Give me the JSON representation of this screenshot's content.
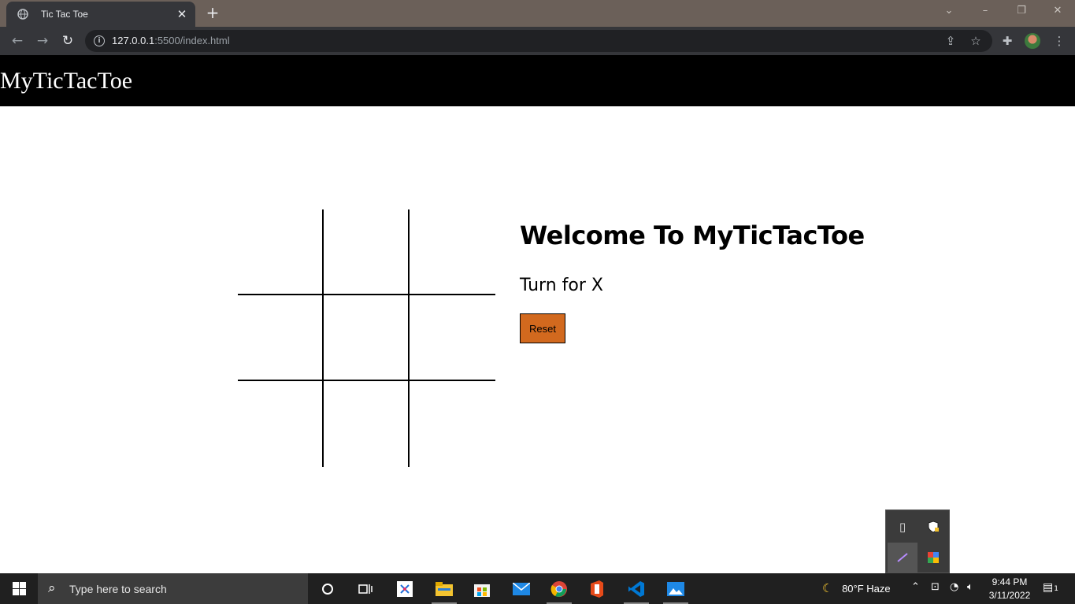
{
  "browser": {
    "tab_title": "Tic Tac Toe",
    "close_tab": "✕",
    "new_tab": "+",
    "url_host": "127.0.0.1",
    "url_rest": ":5500/index.html"
  },
  "page": {
    "site_title": "MyTicTacToe",
    "welcome": "Welcome To MyTicTacToe",
    "turn_text": "Turn for X",
    "reset_label": "Reset",
    "board": [
      "",
      "",
      "",
      "",
      "",
      "",
      "",
      "",
      ""
    ],
    "colors": {
      "header_bg": "#000000",
      "reset_bg": "#d2691e"
    }
  },
  "taskbar": {
    "search_placeholder": "Type here to search",
    "weather": "80°F  Haze",
    "time": "9:44 PM",
    "date": "3/11/2022",
    "notification_count": "1"
  }
}
